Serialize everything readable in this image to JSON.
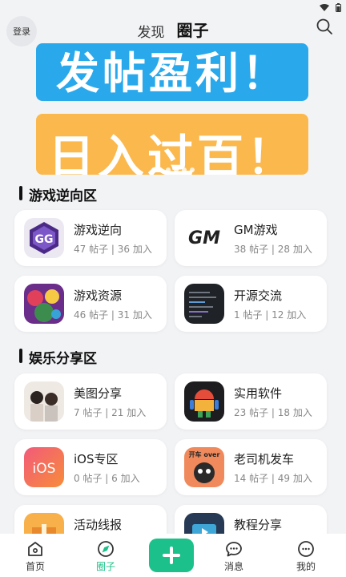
{
  "header": {
    "login_label": "登录",
    "tabs": [
      {
        "label": "发现",
        "active": false
      },
      {
        "label": "圈子",
        "active": true
      }
    ]
  },
  "banner": {
    "top_text": "发帖盈利！",
    "bottom_text": "日入过百！",
    "colors": {
      "top": "#29a9ec",
      "bottom": "#fbb84d"
    }
  },
  "sections": [
    {
      "title": "游戏逆向区",
      "items": [
        {
          "title": "游戏逆向",
          "stats": "47 帖子 | 36 加入",
          "icon": "gameguardian-icon"
        },
        {
          "title": "GM游戏",
          "stats": "38 帖子 | 28 加入",
          "icon": "gm-logo-icon"
        },
        {
          "title": "游戏资源",
          "stats": "46 帖子 | 31 加入",
          "icon": "game-art-icon"
        },
        {
          "title": "开源交流",
          "stats": "1 帖子 | 12 加入",
          "icon": "terminal-icon"
        }
      ]
    },
    {
      "title": "娱乐分享区",
      "items": [
        {
          "title": "美图分享",
          "stats": "7 帖子 | 21 加入",
          "icon": "photo-icon"
        },
        {
          "title": "实用软件",
          "stats": "23 帖子 | 18 加入",
          "icon": "android-icon"
        },
        {
          "title": "iOS专区",
          "stats": "0 帖子 | 6 加入",
          "icon": "ios-icon",
          "icon_text": "iOS"
        },
        {
          "title": "老司机发车",
          "stats": "14 帖子 | 49 加入",
          "icon": "meme-icon",
          "icon_text": "开车 over"
        },
        {
          "title": "活动线报",
          "icon": "gift-icon"
        },
        {
          "title": "教程分享",
          "icon": "video-tutorial-icon"
        }
      ]
    }
  ],
  "gm_logo_text": "GM",
  "nav": [
    {
      "label": "首页",
      "icon": "home-icon"
    },
    {
      "label": "圈子",
      "icon": "compass-icon",
      "active": true
    },
    {
      "label": "消息",
      "icon": "message-icon"
    },
    {
      "label": "我的",
      "icon": "profile-icon"
    }
  ],
  "accent_color": "#1cc08a"
}
